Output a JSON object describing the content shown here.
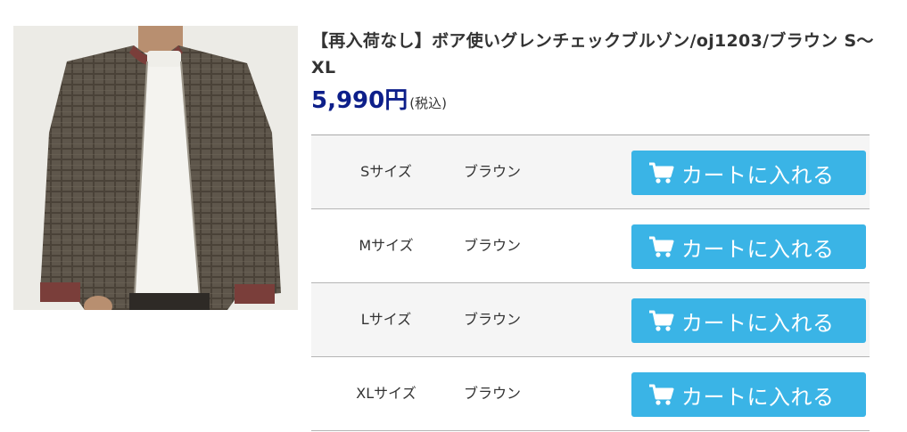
{
  "product": {
    "title": "【再入荷なし】ボア使いグレンチェックブルゾン/oj1203/ブラウン S〜XL",
    "price": "5,990円",
    "tax_note": "(税込)",
    "image_alt": "ボア使いグレンチェックブルゾン"
  },
  "variants": [
    {
      "size": "Sサイズ",
      "color": "ブラウン",
      "button_label": "カートに入れる"
    },
    {
      "size": "Mサイズ",
      "color": "ブラウン",
      "button_label": "カートに入れる"
    },
    {
      "size": "Lサイズ",
      "color": "ブラウン",
      "button_label": "カートに入れる"
    },
    {
      "size": "XLサイズ",
      "color": "ブラウン",
      "button_label": "カートに入れる"
    }
  ],
  "colors": {
    "price": "#0d1f8a",
    "cart_button": "#3ab4e6",
    "row_shade": "#f5f5f5"
  },
  "icons": {
    "cart": "shopping-cart-icon"
  }
}
